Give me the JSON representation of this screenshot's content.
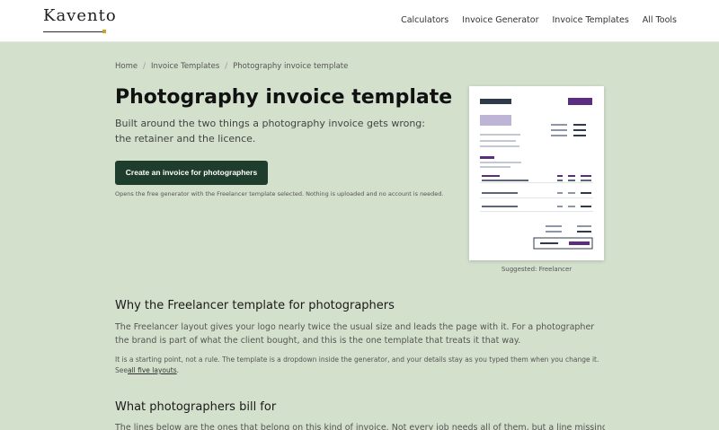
{
  "brand": {
    "name": "Kavento",
    "accent_color": "#c9a227"
  },
  "nav": {
    "items": [
      "Calculators",
      "Invoice Generator",
      "Invoice Templates",
      "All Tools"
    ]
  },
  "breadcrumb": {
    "items": [
      "Home",
      "Invoice Templates",
      "Photography invoice template"
    ],
    "separator": "/"
  },
  "hero": {
    "title": "Photography invoice template",
    "lead": "Built around the two things a photography invoice gets wrong: the retainer and the licence.",
    "cta_label": "Create an invoice for photographers",
    "cta_note": "Opens the free generator with the Freelancer template selected. Nothing is uploaded and no account is needed."
  },
  "preview": {
    "caption": "Suggested: Freelancer",
    "accent_color": "#5b2d82"
  },
  "section1": {
    "title": "Why the Freelancer template for photographers",
    "body": "The Freelancer layout gives your logo nearly twice the usual size and leads the page with it. For a photographer the brand is part of what the client bought, and this is the one template that treats it that way.",
    "note_prefix": "It is a starting point, not a rule. The template is a dropdown inside the generator, and your details stay as you typed them when you change it. See",
    "note_link": "all five layouts",
    "note_suffix": "."
  },
  "section2": {
    "title": "What photographers bill for",
    "body": "The lines below are the ones that belong on this kind of invoice. Not every job needs all of them, but a line missing here is"
  },
  "colors": {
    "background": "#d3e0cc",
    "header": "#ffffff",
    "cta": "#1f3d2c"
  }
}
